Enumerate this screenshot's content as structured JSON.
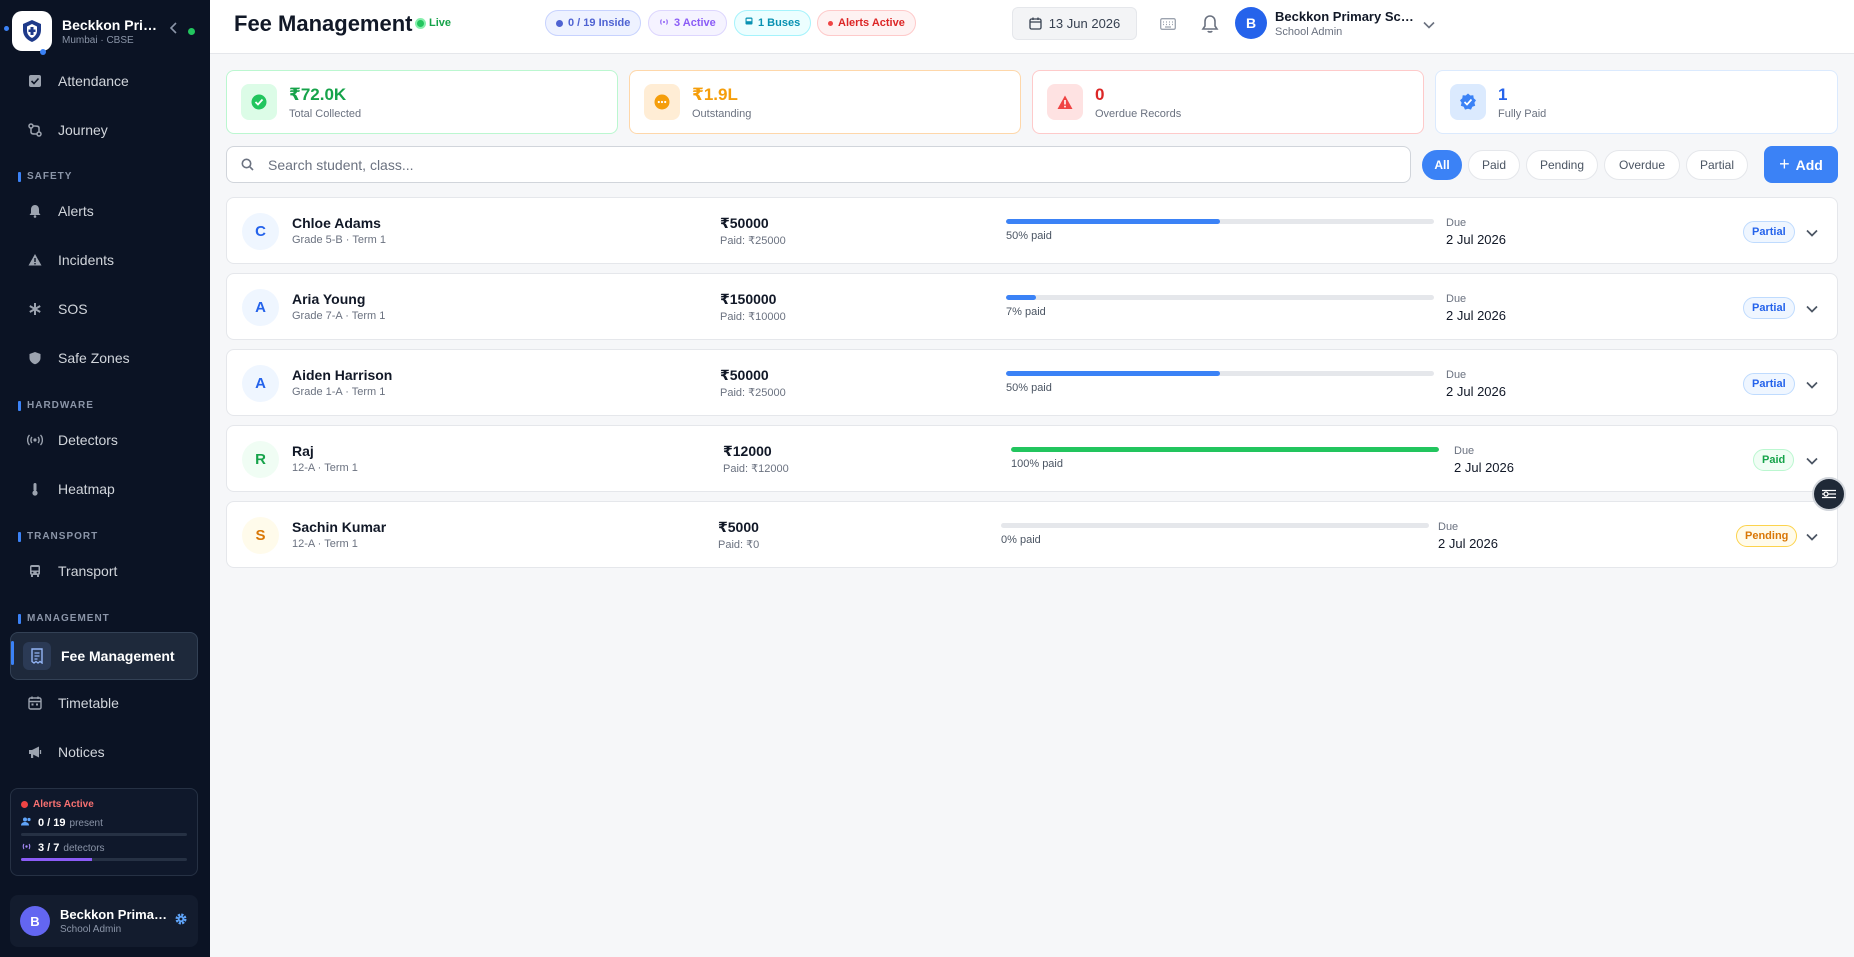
{
  "brand": {
    "name": "Beckkon Primary School",
    "sub": "Mumbai · CBSE"
  },
  "sidebar": {
    "items": [
      {
        "label": "Attendance"
      },
      {
        "label": "Journey"
      },
      {
        "label": "Alerts"
      },
      {
        "label": "Incidents"
      },
      {
        "label": "SOS"
      },
      {
        "label": "Safe Zones"
      },
      {
        "label": "Detectors"
      },
      {
        "label": "Heatmap"
      },
      {
        "label": "Transport"
      },
      {
        "label": "Fee Management"
      },
      {
        "label": "Timetable"
      },
      {
        "label": "Notices"
      }
    ],
    "sections": {
      "safety": "SAFETY",
      "hardware": "HARDWARE",
      "transport": "TRANSPORT",
      "management": "MANAGEMENT"
    },
    "status": {
      "title": "Alerts Active",
      "present_value": "0 / 19",
      "present_label": "present",
      "present_fraction": 0,
      "detectors_value": "3 / 7",
      "detectors_label": "detectors",
      "detectors_fraction": 0.43
    },
    "user": {
      "initial": "B",
      "name": "Beckkon Primary School",
      "role": "School Admin"
    }
  },
  "header": {
    "title": "Fee Management",
    "live": "Live",
    "pills": {
      "inside": "0 / 19 Inside",
      "active": "3 Active",
      "buses": "1 Buses",
      "alerts": "Alerts Active"
    },
    "date": "13 Jun 2026",
    "user": {
      "initial": "B",
      "name": "Beckkon Primary School",
      "role": "School Admin"
    }
  },
  "kpis": {
    "collected": {
      "value": "₹72.0K",
      "label": "Total Collected"
    },
    "outstanding": {
      "value": "₹1.9L",
      "label": "Outstanding"
    },
    "overdue": {
      "value": "0",
      "label": "Overdue Records"
    },
    "fully_paid": {
      "value": "1",
      "label": "Fully Paid"
    }
  },
  "search": {
    "placeholder": "Search student, class..."
  },
  "filters": {
    "all": "All",
    "paid": "Paid",
    "pending": "Pending",
    "overdue": "Overdue",
    "partial": "Partial"
  },
  "add_label": "Add",
  "colors": {
    "accent": "#3b82f6",
    "paid": "#22c55e",
    "pending": "#f59e0b",
    "sidebar": "#0b1324"
  },
  "records": [
    {
      "initial": "C",
      "name": "Chloe Adams",
      "sub": "Grade 5-B · Term 1",
      "amount": "₹50000",
      "paid": "Paid: ₹25000",
      "fraction": 0.5,
      "pct": "50% paid",
      "due_label": "Due",
      "due": "2 Jul 2026",
      "status": "Partial"
    },
    {
      "initial": "A",
      "name": "Aria Young",
      "sub": "Grade 7-A · Term 1",
      "amount": "₹150000",
      "paid": "Paid: ₹10000",
      "fraction": 0.07,
      "pct": "7% paid",
      "due_label": "Due",
      "due": "2 Jul 2026",
      "status": "Partial"
    },
    {
      "initial": "A",
      "name": "Aiden Harrison",
      "sub": "Grade 1-A · Term 1",
      "amount": "₹50000",
      "paid": "Paid: ₹25000",
      "fraction": 0.5,
      "pct": "50% paid",
      "due_label": "Due",
      "due": "2 Jul 2026",
      "status": "Partial"
    },
    {
      "initial": "R",
      "name": "Raj",
      "sub": "12-A · Term 1",
      "amount": "₹12000",
      "paid": "Paid: ₹12000",
      "fraction": 1.0,
      "pct": "100% paid",
      "due_label": "Due",
      "due": "2 Jul 2026",
      "status": "Paid"
    },
    {
      "initial": "S",
      "name": "Sachin Kumar",
      "sub": "12-A · Term 1",
      "amount": "₹5000",
      "paid": "Paid: ₹0",
      "fraction": 0,
      "pct": "0% paid",
      "due_label": "Due",
      "due": "2 Jul 2026",
      "status": "Pending"
    }
  ]
}
